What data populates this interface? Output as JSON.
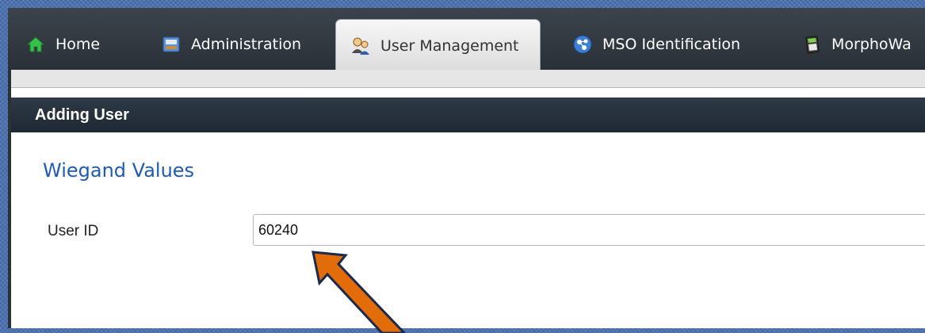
{
  "tabs": [
    {
      "label": "Home",
      "icon": "home-icon",
      "active": false
    },
    {
      "label": "Administration",
      "icon": "administration-icon",
      "active": false
    },
    {
      "label": "User Management",
      "icon": "users-icon",
      "active": true
    },
    {
      "label": "MSO Identification",
      "icon": "fingerprint-network-icon",
      "active": false
    },
    {
      "label": "MorphoWa",
      "icon": "device-icon",
      "active": false
    }
  ],
  "panel": {
    "title": "Adding User",
    "group_title": "Wiegand Values",
    "fields": [
      {
        "label": "User ID",
        "value": "60240"
      }
    ]
  },
  "annotation": {
    "icon": "orange-arrow-icon",
    "color": "#e36c0a"
  },
  "colors": {
    "accent": "#1f5bb5",
    "header": "#1f2833"
  }
}
